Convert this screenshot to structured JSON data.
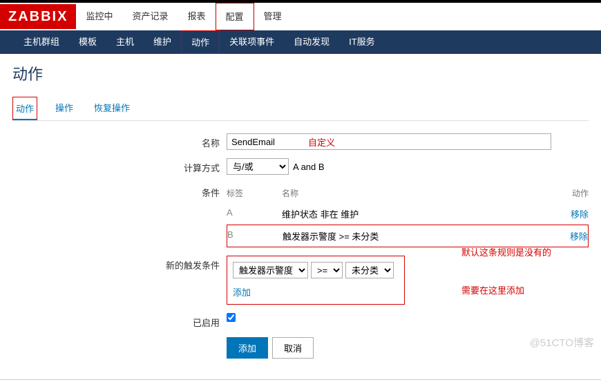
{
  "logo": "ZABBIX",
  "topnav": {
    "items": [
      "监控中",
      "资产记录",
      "报表",
      "配置",
      "管理"
    ],
    "activeIndex": 3
  },
  "subnav": {
    "items": [
      "主机群组",
      "模板",
      "主机",
      "维护",
      "动作",
      "关联项事件",
      "自动发现",
      "IT服务"
    ],
    "activeIndex": 4
  },
  "pageTitle": "动作",
  "tabs": {
    "items": [
      "动作",
      "操作",
      "恢复操作"
    ],
    "activeIndex": 0
  },
  "form": {
    "nameLabel": "名称",
    "nameValue": "SendEmail",
    "nameHint": "自定义",
    "calcLabel": "计算方式",
    "calcValue": "与/或",
    "calcNote": "A and B",
    "condLabel": "条件",
    "condHeaders": {
      "tag": "标签",
      "name": "名称",
      "action": "动作"
    },
    "conds": [
      {
        "tag": "A",
        "name": "维护状态 非在 维护",
        "action": "移除",
        "highlight": false
      },
      {
        "tag": "B",
        "name": "触发器示警度 >= 未分类",
        "action": "移除",
        "highlight": true
      }
    ],
    "newCondLabel": "新的触发条件",
    "newCond": {
      "field": "触发器示警度",
      "op": ">=",
      "value": "未分类",
      "addLink": "添加"
    },
    "enabledLabel": "已启用",
    "enabledChecked": true,
    "buttons": {
      "submit": "添加",
      "cancel": "取消"
    },
    "annot1": "默认这条规则是没有的",
    "annot2": "需要在这里添加"
  },
  "watermark": "@51CTO博客"
}
